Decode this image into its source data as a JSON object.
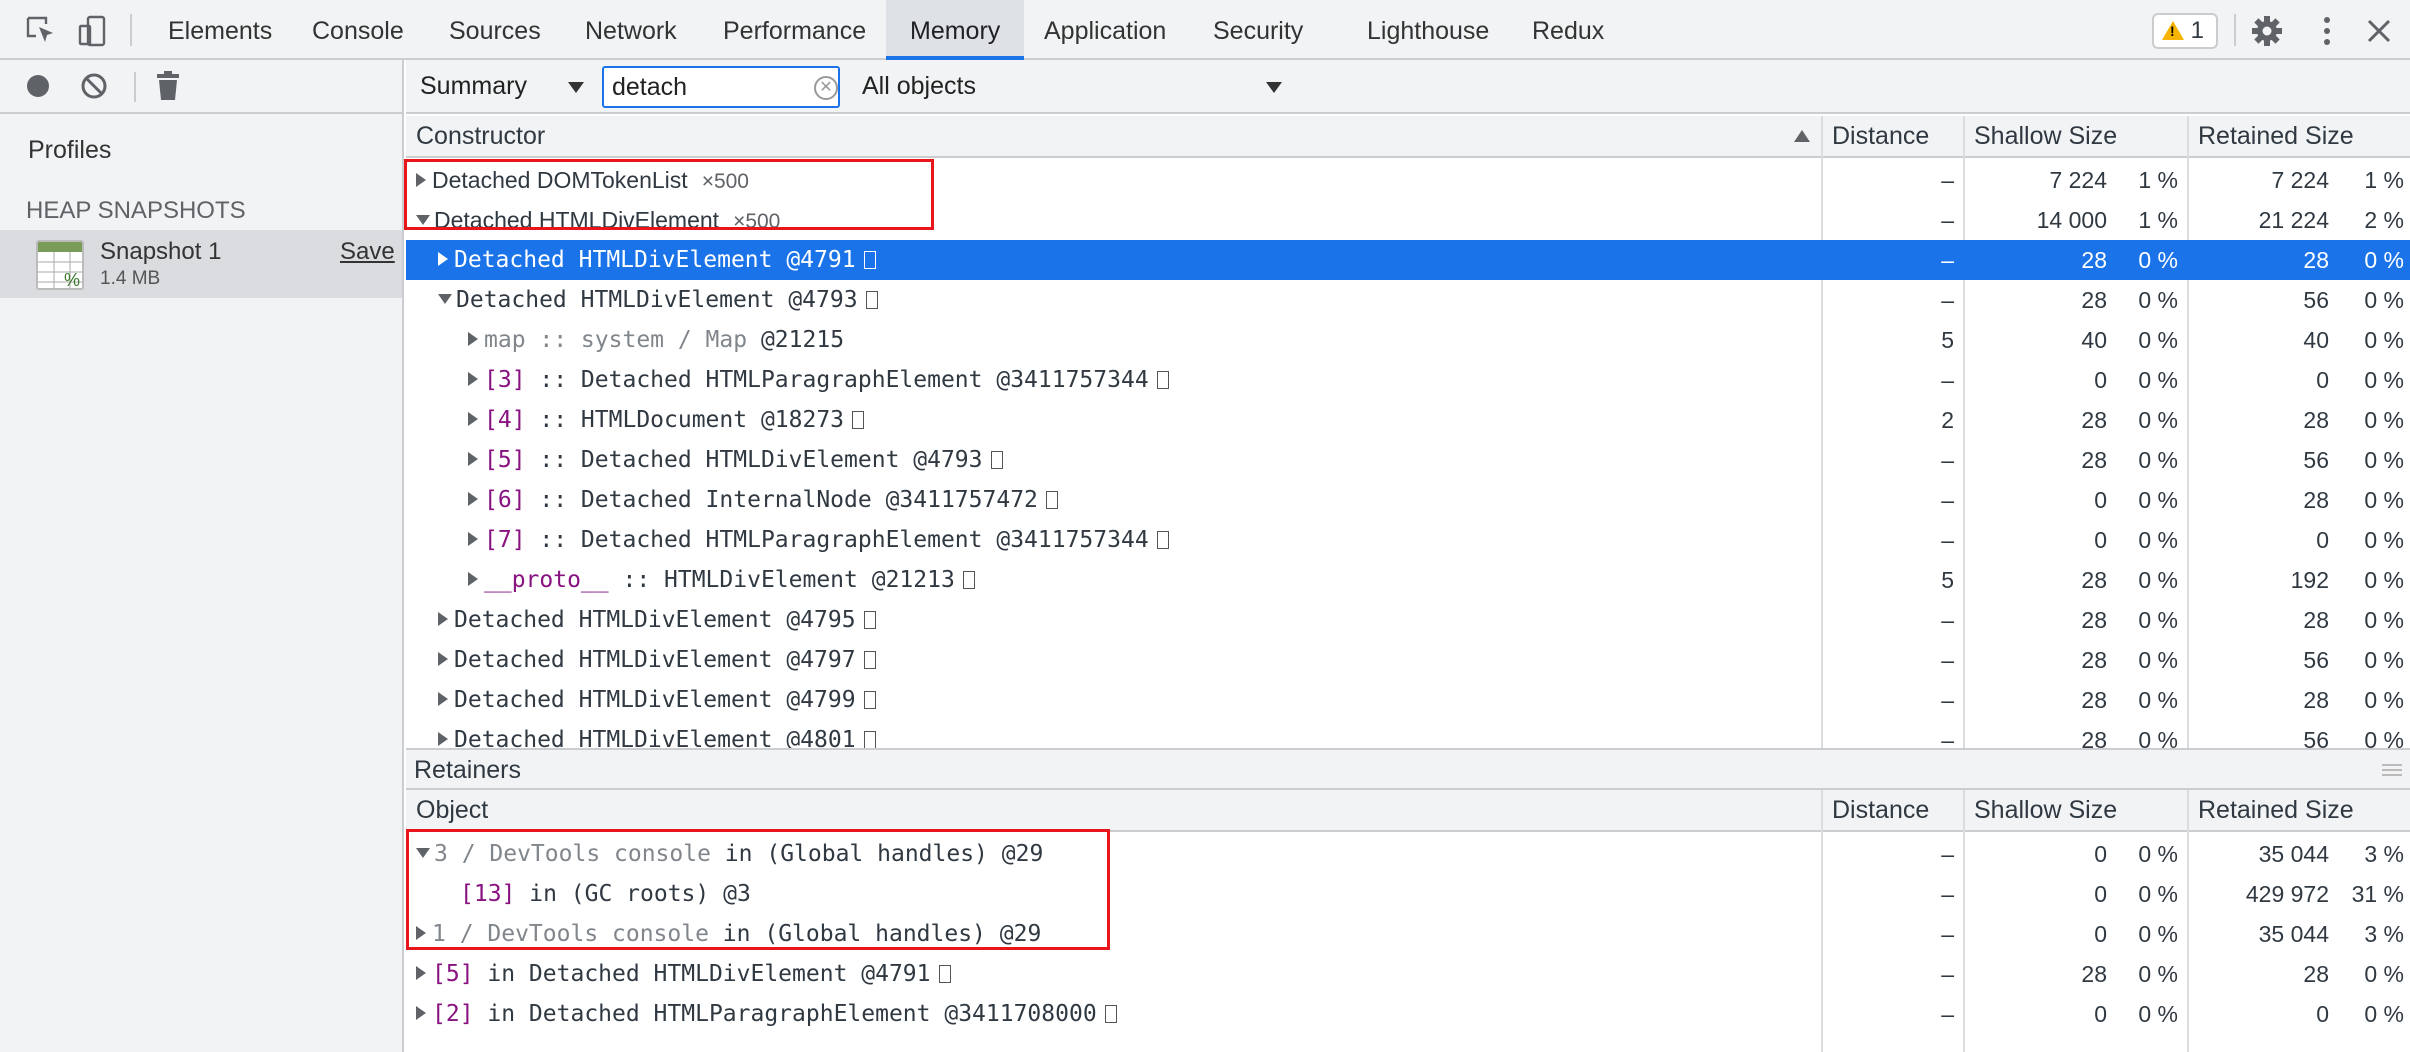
{
  "tabs": [
    {
      "label": "Elements"
    },
    {
      "label": "Console"
    },
    {
      "label": "Sources"
    },
    {
      "label": "Network"
    },
    {
      "label": "Performance"
    },
    {
      "label": "Memory"
    },
    {
      "label": "Application"
    },
    {
      "label": "Security"
    },
    {
      "label": "Lighthouse"
    },
    {
      "label": "Redux"
    }
  ],
  "active_tab": "Memory",
  "warnings_count": "1",
  "sidebar": {
    "profiles_label": "Profiles",
    "heap_snapshots_label": "HEAP SNAPSHOTS",
    "snapshot": {
      "name": "Snapshot 1",
      "size": "1.4 MB",
      "save_label": "Save"
    }
  },
  "toolbar": {
    "view_select": "Summary",
    "filter_value": "detach",
    "objects_select": "All objects"
  },
  "summary_grid": {
    "headers": {
      "constructor": "Constructor",
      "distance": "Distance",
      "shallow": "Shallow Size",
      "retained": "Retained Size"
    },
    "rows": [
      {
        "segs": [
          {
            "t": "Detached DOMTokenList"
          },
          {
            "t": "×500",
            "cls": "count"
          }
        ],
        "distance": "–",
        "shallow": "7 224",
        "shallow_pct": "1 %",
        "retained": "7 224",
        "retained_pct": "1 %"
      },
      {
        "segs": [
          {
            "t": "Detached HTMLDivElement"
          },
          {
            "t": "×500",
            "cls": "count"
          }
        ],
        "distance": "–",
        "shallow": "14 000",
        "shallow_pct": "1 %",
        "retained": "21 224",
        "retained_pct": "2 %"
      },
      {
        "segs": [
          {
            "t": "Detached HTMLDivElement @4791"
          }
        ],
        "distance": "–",
        "shallow": "28",
        "shallow_pct": "0 %",
        "retained": "28",
        "retained_pct": "0 %"
      },
      {
        "segs": [
          {
            "t": "Detached HTMLDivElement @4793"
          }
        ],
        "distance": "–",
        "shallow": "28",
        "shallow_pct": "0 %",
        "retained": "56",
        "retained_pct": "0 %"
      },
      {
        "segs": [
          {
            "t": "map :: system / Map",
            "cls": "gray"
          },
          {
            "t": " @21215"
          }
        ],
        "distance": "5",
        "shallow": "40",
        "shallow_pct": "0 %",
        "retained": "40",
        "retained_pct": "0 %"
      },
      {
        "segs": [
          {
            "t": "[3]",
            "cls": "purple"
          },
          {
            "t": " :: Detached HTMLParagraphElement @3411757344"
          }
        ],
        "distance": "–",
        "shallow": "0",
        "shallow_pct": "0 %",
        "retained": "0",
        "retained_pct": "0 %"
      },
      {
        "segs": [
          {
            "t": "[4]",
            "cls": "purple"
          },
          {
            "t": " :: HTMLDocument @18273"
          }
        ],
        "distance": "2",
        "shallow": "28",
        "shallow_pct": "0 %",
        "retained": "28",
        "retained_pct": "0 %"
      },
      {
        "segs": [
          {
            "t": "[5]",
            "cls": "purple"
          },
          {
            "t": " :: Detached HTMLDivElement @4793"
          }
        ],
        "distance": "–",
        "shallow": "28",
        "shallow_pct": "0 %",
        "retained": "56",
        "retained_pct": "0 %"
      },
      {
        "segs": [
          {
            "t": "[6]",
            "cls": "purple"
          },
          {
            "t": " :: Detached InternalNode @3411757472"
          }
        ],
        "distance": "–",
        "shallow": "0",
        "shallow_pct": "0 %",
        "retained": "28",
        "retained_pct": "0 %"
      },
      {
        "segs": [
          {
            "t": "[7]",
            "cls": "purple"
          },
          {
            "t": " :: Detached HTMLParagraphElement @3411757344"
          }
        ],
        "distance": "–",
        "shallow": "0",
        "shallow_pct": "0 %",
        "retained": "0",
        "retained_pct": "0 %"
      },
      {
        "segs": [
          {
            "t": "__proto__",
            "cls": "purple"
          },
          {
            "t": " :: HTMLDivElement @21213"
          }
        ],
        "distance": "5",
        "shallow": "28",
        "shallow_pct": "0 %",
        "retained": "192",
        "retained_pct": "0 %"
      },
      {
        "segs": [
          {
            "t": "Detached HTMLDivElement @4795"
          }
        ],
        "distance": "–",
        "shallow": "28",
        "shallow_pct": "0 %",
        "retained": "28",
        "retained_pct": "0 %"
      },
      {
        "segs": [
          {
            "t": "Detached HTMLDivElement @4797"
          }
        ],
        "distance": "–",
        "shallow": "28",
        "shallow_pct": "0 %",
        "retained": "56",
        "retained_pct": "0 %"
      },
      {
        "segs": [
          {
            "t": "Detached HTMLDivElement @4799"
          }
        ],
        "distance": "–",
        "shallow": "28",
        "shallow_pct": "0 %",
        "retained": "28",
        "retained_pct": "0 %"
      },
      {
        "segs": [
          {
            "t": "Detached HTMLDivElement @4801"
          }
        ],
        "distance": "–",
        "shallow": "28",
        "shallow_pct": "0 %",
        "retained": "56",
        "retained_pct": "0 %"
      }
    ]
  },
  "retainers": {
    "title": "Retainers",
    "headers": {
      "object": "Object",
      "distance": "Distance",
      "shallow": "Shallow Size",
      "retained": "Retained Size"
    },
    "rows": [
      {
        "segs": [
          {
            "t": "3 / DevTools console",
            "cls": "gray"
          },
          {
            "t": " in (Global handles) @29"
          }
        ],
        "distance": "–",
        "shallow": "0",
        "shallow_pct": "0 %",
        "retained": "35 044",
        "retained_pct": "3 %"
      },
      {
        "segs": [
          {
            "t": "[13]",
            "cls": "purple"
          },
          {
            "t": " in (GC roots) @3"
          }
        ],
        "distance": "–",
        "shallow": "0",
        "shallow_pct": "0 %",
        "retained": "429 972",
        "retained_pct": "31 %"
      },
      {
        "segs": [
          {
            "t": "1 / DevTools console",
            "cls": "gray"
          },
          {
            "t": " in (Global handles) @29"
          }
        ],
        "distance": "–",
        "shallow": "0",
        "shallow_pct": "0 %",
        "retained": "35 044",
        "retained_pct": "3 %"
      },
      {
        "segs": [
          {
            "t": "[5]",
            "cls": "purple"
          },
          {
            "t": " in Detached HTMLDivElement @4791"
          }
        ],
        "distance": "–",
        "shallow": "28",
        "shallow_pct": "0 %",
        "retained": "28",
        "retained_pct": "0 %"
      },
      {
        "segs": [
          {
            "t": "[2]",
            "cls": "purple"
          },
          {
            "t": " in Detached HTMLParagraphElement @3411708000"
          }
        ],
        "distance": "–",
        "shallow": "0",
        "shallow_pct": "0 %",
        "retained": "0",
        "retained_pct": "0 %"
      }
    ]
  }
}
